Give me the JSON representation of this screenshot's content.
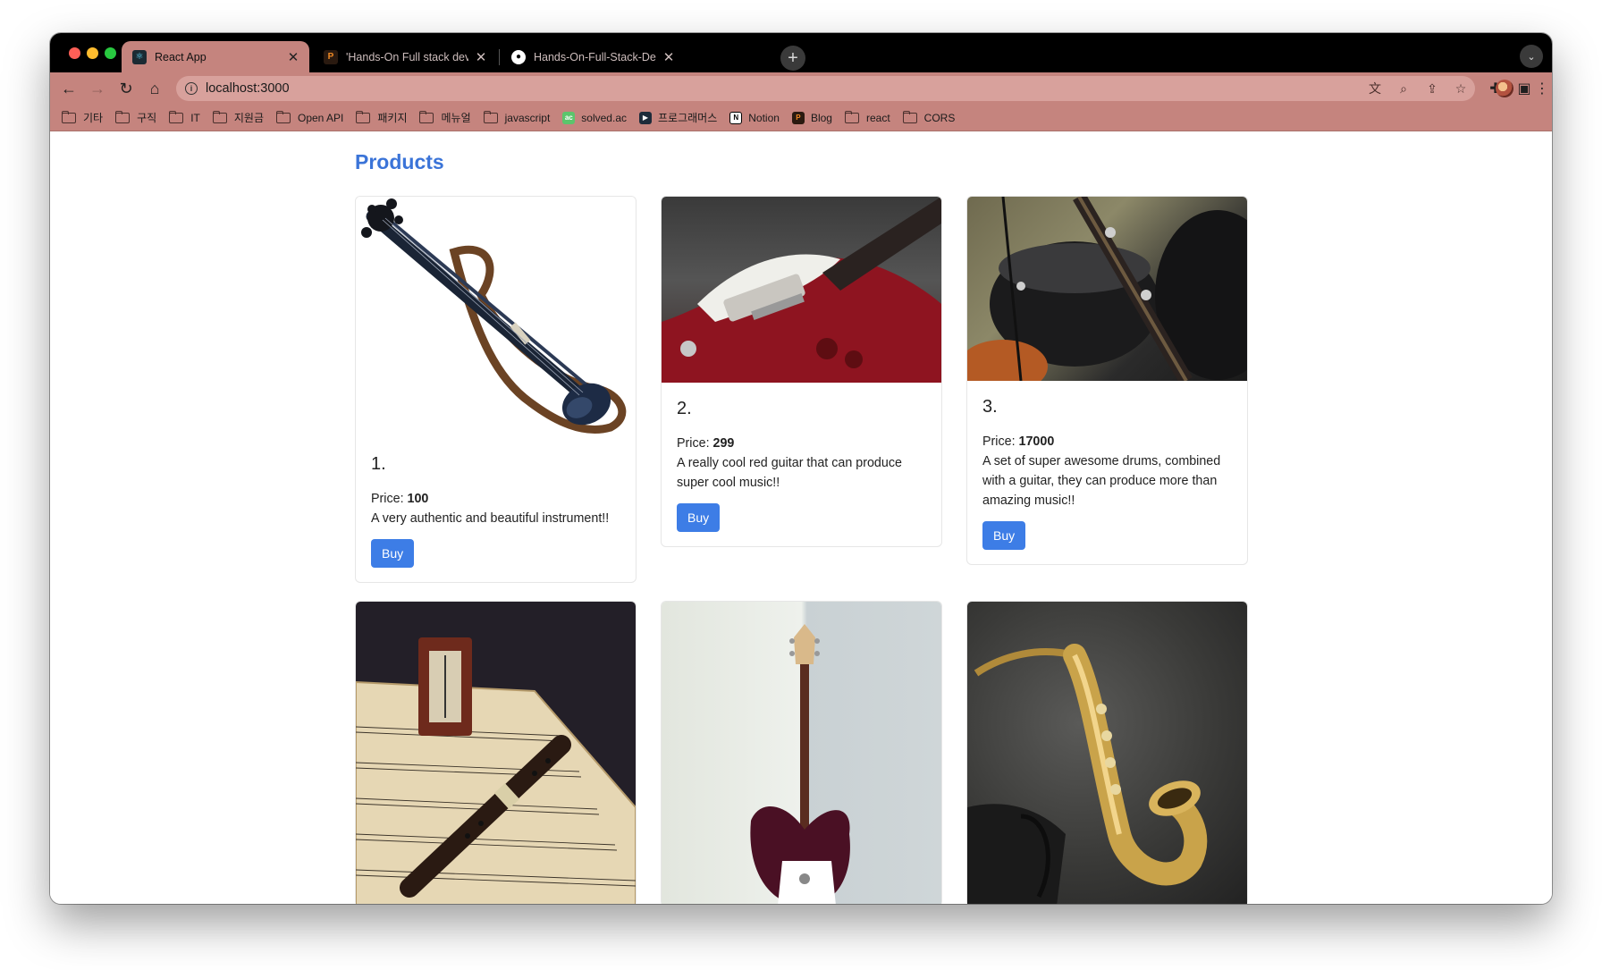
{
  "browser": {
    "tabs": [
      {
        "title": "React App",
        "favicon": "react-icon",
        "active": true
      },
      {
        "title": "'Hands-On Full stack developm",
        "favicon": "packt-icon",
        "active": false
      },
      {
        "title": "Hands-On-Full-Stack-Develop",
        "favicon": "github-icon",
        "active": false
      }
    ],
    "url": "localhost:3000",
    "bookmarks": [
      {
        "label": "기타",
        "icon": "folder-icon"
      },
      {
        "label": "구직",
        "icon": "folder-icon"
      },
      {
        "label": "IT",
        "icon": "folder-icon"
      },
      {
        "label": "지원금",
        "icon": "folder-icon"
      },
      {
        "label": "Open API",
        "icon": "folder-icon"
      },
      {
        "label": "패키지",
        "icon": "folder-icon"
      },
      {
        "label": "메뉴얼",
        "icon": "folder-icon"
      },
      {
        "label": "javascript",
        "icon": "folder-icon"
      },
      {
        "label": "solved.ac",
        "icon": "solvedac-icon"
      },
      {
        "label": "프로그래머스",
        "icon": "programmers-icon"
      },
      {
        "label": "Notion",
        "icon": "notion-icon"
      },
      {
        "label": "Blog",
        "icon": "blog-icon"
      },
      {
        "label": "react",
        "icon": "folder-icon"
      },
      {
        "label": "CORS",
        "icon": "folder-icon"
      }
    ]
  },
  "page": {
    "title": "Products",
    "price_label": "Price:",
    "products": [
      {
        "title": "1.",
        "price": "100",
        "description": "A very authentic and beautiful instrument!!",
        "button": "Buy",
        "image": "electric-violin-image"
      },
      {
        "title": "2.",
        "price": "299",
        "description": "A really cool red guitar that can produce super cool music!!",
        "button": "Buy",
        "image": "red-guitar-image"
      },
      {
        "title": "3.",
        "price": "17000",
        "description": "A set of super awesome drums, combined with a guitar, they can produce more than amazing music!!",
        "button": "Buy",
        "image": "drums-guitar-image"
      },
      {
        "image": "recorder-metronome-image"
      },
      {
        "image": "guitar-wall-image"
      },
      {
        "image": "saxophone-image"
      }
    ]
  },
  "colors": {
    "tab_accent": "#c5847e",
    "link_blue": "#3b74d8",
    "button_blue": "#3d7de6"
  }
}
